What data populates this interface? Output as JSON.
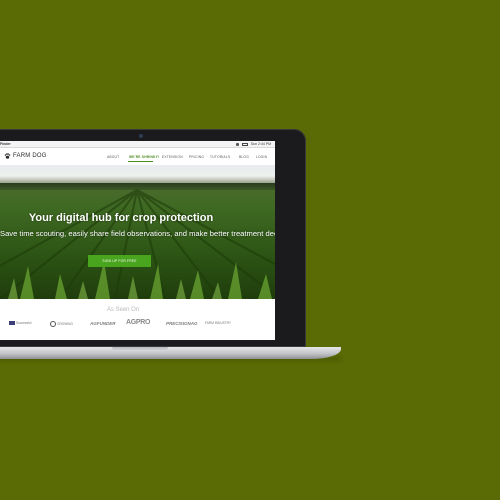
{
  "menubar": {
    "app_name": "Finder",
    "clock": "Sun 2:44 PM"
  },
  "site": {
    "logo_text": "FARM DOG",
    "nav": [
      {
        "label": "ABOUT",
        "active": false
      },
      {
        "label": "WE'RE SHRINKY!",
        "active": true
      },
      {
        "label": "EXTENSION",
        "active": false
      },
      {
        "label": "PRICING",
        "active": false
      },
      {
        "label": "TUTORIALS",
        "active": false
      },
      {
        "label": "BLOG",
        "active": false
      },
      {
        "label": "LOGIN",
        "active": false
      }
    ]
  },
  "hero": {
    "title": "Your digital hub for crop protection",
    "subtitle": "Save time scouting, easily share field observations, and make better treatment decisions",
    "cta_label": "SIGN UP FOR FREE"
  },
  "as_seen_on": {
    "title": "As Seen On",
    "logos": [
      {
        "name": "Successful Farming",
        "text": "Successful"
      },
      {
        "name": "Growing Produce",
        "text": "GROWING"
      },
      {
        "name": "AgFunder",
        "text": "AGFUNDER"
      },
      {
        "name": "AgPro",
        "text": "AGPRO"
      },
      {
        "name": "Precision Ag",
        "text": "PRECISIONAG"
      },
      {
        "name": "Farm Industry News",
        "text": "FARM INDUSTRY"
      }
    ]
  },
  "colors": {
    "background": "#5a6a04",
    "accent": "#49a51e",
    "active_nav": "#4e8b20"
  }
}
